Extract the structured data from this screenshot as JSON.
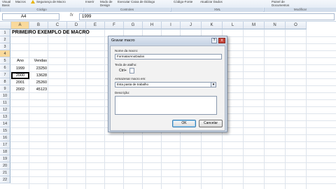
{
  "ribbon": {
    "items": [
      {
        "label": "Visual",
        "sub": "Basic"
      },
      {
        "label": "Macros"
      },
      {
        "label": "Segurança de Macro"
      },
      {
        "label": "Inserir"
      },
      {
        "label": "Modo de",
        "sub": "Design"
      },
      {
        "label": "Executar Caixa de Diálogo"
      },
      {
        "label": "Código-Fonte"
      },
      {
        "label": "Atualizar Dados"
      },
      {
        "label": "Painel de",
        "sub": "Documentos"
      }
    ],
    "groups": [
      "Código",
      "Controles",
      "XML",
      "Modificar"
    ]
  },
  "formula_bar": {
    "name_box": "A4",
    "fx": "fx",
    "formula": "1999"
  },
  "grid": {
    "columns": [
      "A",
      "B",
      "C",
      "D",
      "E",
      "F",
      "G",
      "H",
      "I",
      "J",
      "K",
      "L",
      "M",
      "N",
      "O"
    ],
    "active_column": "A",
    "rows": [
      "1",
      "2",
      "3",
      "4",
      "5",
      "6",
      "7",
      "8",
      "9",
      "10",
      "11",
      "12",
      "13",
      "14",
      "15",
      "16",
      "17",
      "18",
      "19",
      "20",
      "21",
      "22"
    ],
    "active_row": "4"
  },
  "sheet": {
    "title": "PRIMEIRO EXEMPLO DE MACRO",
    "header_ano": "Ano",
    "header_vendas": "Vendas",
    "data": [
      {
        "ano": "1999",
        "vendas": "23250"
      },
      {
        "ano": "2000",
        "vendas": "13628"
      },
      {
        "ano": "2001",
        "vendas": "25260"
      },
      {
        "ano": "2002",
        "vendas": "45123"
      }
    ]
  },
  "dialog": {
    "title": "Gravar macro",
    "help": "?",
    "close": "x",
    "name_label": "Nome da macro:",
    "name_value": "FormatarAnoDados",
    "shortcut_label": "Tecla de atalho:",
    "shortcut_prefix": "Ctrl+",
    "shortcut_value": "",
    "store_label": "Armazenar macro em:",
    "store_value": "Esta pasta de trabalho",
    "desc_label": "Descrição:",
    "desc_value": "",
    "ok": "OK",
    "cancel": "Cancelar"
  }
}
